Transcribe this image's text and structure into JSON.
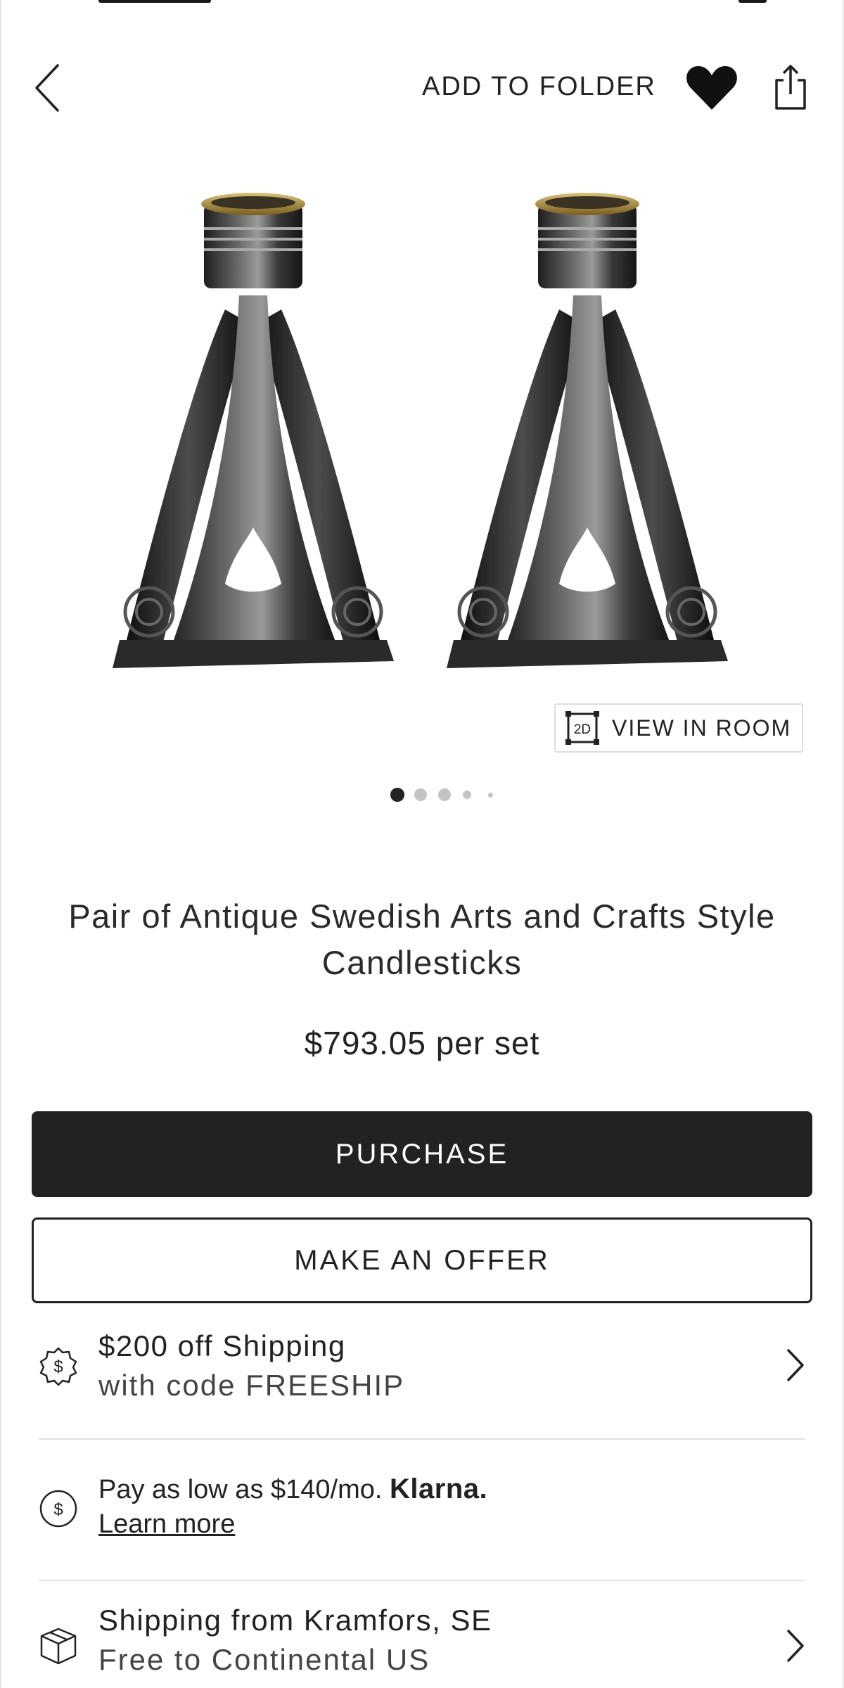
{
  "header": {
    "add_to_folder_label": "ADD TO FOLDER"
  },
  "gallery": {
    "view_in_room_label": "VIEW IN ROOM",
    "view_in_room_badge": "2D",
    "image_count": 5,
    "active_index": 0
  },
  "product": {
    "title": "Pair of Antique Swedish Arts and Crafts Style Candlesticks",
    "price": "$793.05 per set"
  },
  "actions": {
    "purchase_label": "PURCHASE",
    "offer_label": "MAKE AN OFFER"
  },
  "promos": {
    "shipping_discount": {
      "title": "$200 off Shipping",
      "subtitle": "with code FREESHIP"
    },
    "financing": {
      "text": "Pay as low as $140/mo.",
      "brand": "Klarna.",
      "link": "Learn more"
    },
    "shipping_origin": {
      "title": "Shipping from Kramfors, SE",
      "subtitle": "Free to Continental US"
    }
  },
  "icons": {
    "back": "chevron-left-icon",
    "favorite": "heart-icon",
    "share": "share-icon",
    "view_in_room": "2d-view-icon",
    "shipping_discount": "dollar-badge-icon",
    "financing": "dollar-circle-icon",
    "shipping_origin": "package-icon",
    "row_chevron": "chevron-right-icon"
  },
  "colors": {
    "primary": "#222222",
    "background": "#ffffff",
    "divider": "#e3e3e3",
    "dot_active": "#222222",
    "dot_inactive": "#c4c4c4"
  }
}
